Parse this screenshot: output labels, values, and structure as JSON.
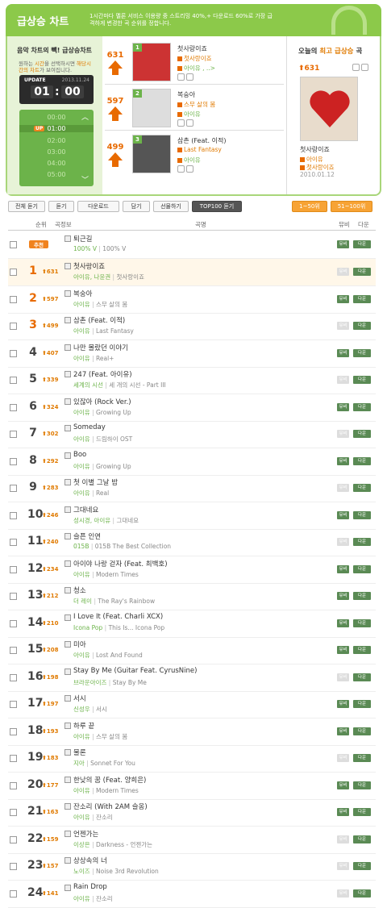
{
  "header": {
    "title": "급상승 차트",
    "desc": "1시간마다 멜론 서비스 이용량 중 스트리밍 40%,+ 다운로드 60%로 가장 급격하게 변경한 곡 순위를 정합니다."
  },
  "left": {
    "title": "음악 차트의 빽! 급상승차트",
    "desc_pre": "원하는 ",
    "desc_hl1": "시간",
    "desc_mid": "을 선택하시면 ",
    "desc_hl2": "해당시간의 차트",
    "desc_post": "가 보여집니다.",
    "update_label": "UPDATE",
    "date": "2013.11.24",
    "hour": "01",
    "minute": "00",
    "up_badge": "UP",
    "times": [
      "00:00",
      "01:00",
      "02:00",
      "03:00",
      "04:00",
      "05:00"
    ]
  },
  "top3": [
    {
      "rank": "1",
      "rise": "631",
      "title": "첫사랑이죠",
      "album": "첫사랑이죠",
      "artist": "아이유 , ..>"
    },
    {
      "rank": "2",
      "rise": "597",
      "title": "복숭아",
      "album": "스무 살의 봄",
      "artist": "아이유"
    },
    {
      "rank": "3",
      "rise": "499",
      "title": "삼촌 (Feat. 이적)",
      "album": "Last Fantasy",
      "artist": "아이유"
    }
  ],
  "right": {
    "title_pre": "오늘의 ",
    "title_hl": "최고 급상승",
    "title_post": " 곡",
    "rise": "631",
    "song": "첫사랑이죠",
    "artist": "아이유",
    "album": "첫사랑이죠",
    "date": "2010.01.12"
  },
  "toolbar": {
    "listen_all": "전체 듣기",
    "listen": "듣기",
    "download": "다운로드",
    "add": "담기",
    "gift": "선물하기",
    "top100": "TOP100 듣기",
    "range1": "1~50위",
    "range2": "51~100위"
  },
  "listhdr": {
    "rank": "순위",
    "info": "곡정보",
    "title": "곡명",
    "mv": "뮤비",
    "down": "다운"
  },
  "pick": {
    "label": "추천",
    "song": "퇴근길",
    "artist": "100% V",
    "album": "100% V"
  },
  "rows": [
    {
      "rank": "1",
      "rise": "631",
      "song": "첫사랑이죠",
      "artist": "아이유, 나윤권",
      "album": "첫사랑이죠",
      "mv": false
    },
    {
      "rank": "2",
      "rise": "597",
      "song": "복숭아",
      "artist": "아이유",
      "album": "스무 살의 봄",
      "mv": true
    },
    {
      "rank": "3",
      "rise": "499",
      "song": "삼촌 (Feat. 이적)",
      "artist": "아이유",
      "album": "Last Fantasy",
      "mv": false
    },
    {
      "rank": "4",
      "rise": "407",
      "song": "나만 몰랐던 이야기",
      "artist": "아이유",
      "album": "Real+",
      "mv": true
    },
    {
      "rank": "5",
      "rise": "339",
      "song": "247 (Feat. 아이유)",
      "artist": "세계의 시선",
      "album": "세 개의 시선 - Part III",
      "mv": false
    },
    {
      "rank": "6",
      "rise": "324",
      "song": "있잖아 (Rock Ver.)",
      "artist": "아이유",
      "album": "Growing Up",
      "mv": true
    },
    {
      "rank": "7",
      "rise": "302",
      "song": "Someday",
      "artist": "아이유",
      "album": "드림하이 OST",
      "mv": false
    },
    {
      "rank": "8",
      "rise": "292",
      "song": "Boo",
      "artist": "아이유",
      "album": "Growing Up",
      "mv": true
    },
    {
      "rank": "9",
      "rise": "283",
      "song": "첫 이별 그날 밤",
      "artist": "아이유",
      "album": "Real",
      "mv": false
    },
    {
      "rank": "10",
      "rise": "246",
      "song": "그대네요",
      "artist": "성시경, 아이유",
      "album": "그대네요",
      "mv": true
    },
    {
      "rank": "11",
      "rise": "240",
      "song": "슬픈 인연",
      "artist": "015B",
      "album": "015B The Best Collection",
      "mv": false
    },
    {
      "rank": "12",
      "rise": "234",
      "song": "아이야 나랑 걷자 (Feat. 최백호)",
      "artist": "아이유",
      "album": "Modern Times",
      "mv": true
    },
    {
      "rank": "13",
      "rise": "212",
      "song": "청소",
      "artist": "더 레이",
      "album": "The Ray's Rainbow",
      "mv": true
    },
    {
      "rank": "14",
      "rise": "210",
      "song": "I Love It (Feat. Charli XCX)",
      "artist": "Icona Pop",
      "album": "This Is... Icona Pop",
      "mv": true
    },
    {
      "rank": "15",
      "rise": "208",
      "song": "미아",
      "artist": "아이유",
      "album": "Lost And Found",
      "mv": true
    },
    {
      "rank": "16",
      "rise": "198",
      "song": "Stay By Me (Guitar Feat. CyrusNine)",
      "artist": "브라운아이즈",
      "album": "Stay By Me",
      "mv": false
    },
    {
      "rank": "17",
      "rise": "197",
      "song": "서시",
      "artist": "신성우",
      "album": "서시",
      "mv": true
    },
    {
      "rank": "18",
      "rise": "193",
      "song": "하루 끝",
      "artist": "아이유",
      "album": "스무 살의 봄",
      "mv": true
    },
    {
      "rank": "19",
      "rise": "183",
      "song": "물론",
      "artist": "지아",
      "album": "Sonnet For You",
      "mv": false
    },
    {
      "rank": "20",
      "rise": "177",
      "song": "한낮의 꿈 (Feat. 양희은)",
      "artist": "아이유",
      "album": "Modern Times",
      "mv": true
    },
    {
      "rank": "21",
      "rise": "163",
      "song": "잔소리 (With 2AM 슬옹)",
      "artist": "아이유",
      "album": "잔소리",
      "mv": true
    },
    {
      "rank": "22",
      "rise": "159",
      "song": "언젠가는",
      "artist": "이상은",
      "album": "Darkness - 언젠가는",
      "mv": false
    },
    {
      "rank": "23",
      "rise": "157",
      "song": "상상속의 너",
      "artist": "노이즈",
      "album": "Noise 3rd Revolution",
      "mv": false
    },
    {
      "rank": "24",
      "rise": "141",
      "song": "Rain Drop",
      "artist": "아이유",
      "album": "잔소리",
      "mv": false
    }
  ],
  "mv_label": "뮤비",
  "dl_label": "다운"
}
